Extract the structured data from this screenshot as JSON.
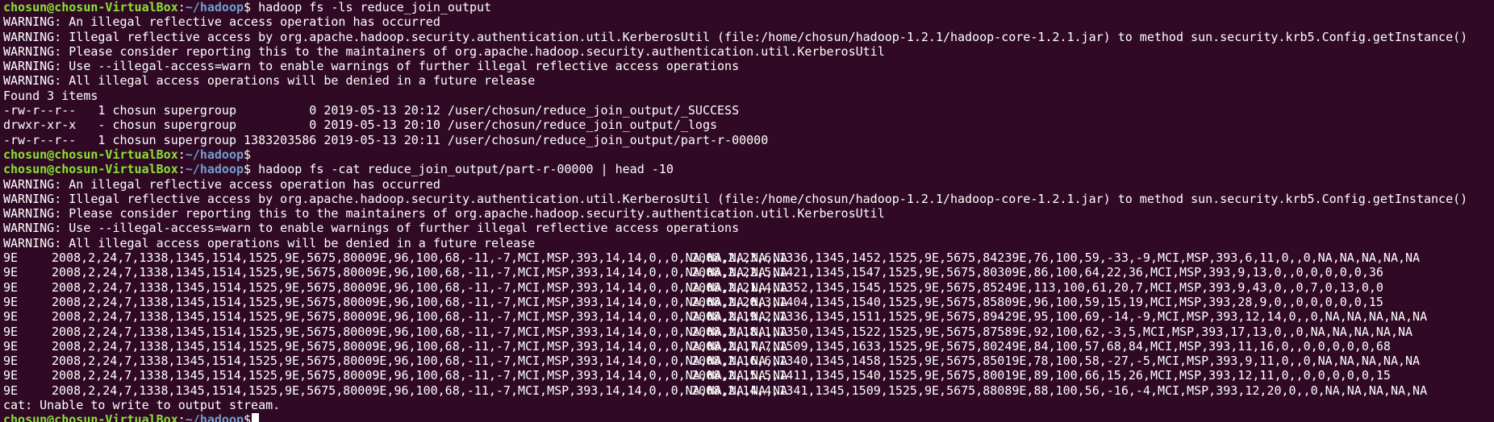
{
  "prompt": {
    "user_host": "chosun@chosun-VirtualBox",
    "colon": ":",
    "path": "~/hadoop",
    "symbol": "$"
  },
  "commands": {
    "ls": " hadoop fs -ls reduce_join_output",
    "cat": " hadoop fs -cat reduce_join_output/part-r-00000 | head -10",
    "empty": ""
  },
  "warnings": [
    "WARNING: An illegal reflective access operation has occurred",
    "WARNING: Illegal reflective access by org.apache.hadoop.security.authentication.util.KerberosUtil (file:/home/chosun/hadoop-1.2.1/hadoop-core-1.2.1.jar) to method sun.security.krb5.Config.getInstance()",
    "WARNING: Please consider reporting this to the maintainers of org.apache.hadoop.security.authentication.util.KerberosUtil",
    "WARNING: Use --illegal-access=warn to enable warnings of further illegal reflective access operations",
    "WARNING: All illegal access operations will be denied in a future release"
  ],
  "ls_output": {
    "found": "Found 3 items",
    "entries": [
      "-rw-r--r--   1 chosun supergroup          0 2019-05-13 20:12 /user/chosun/reduce_join_output/_SUCCESS",
      "drwxr-xr-x   - chosun supergroup          0 2019-05-13 20:10 /user/chosun/reduce_join_output/_logs",
      "-rw-r--r--   1 chosun supergroup 1383203586 2019-05-13 20:11 /user/chosun/reduce_join_output/part-r-00000"
    ]
  },
  "cat_output": {
    "rows": [
      {
        "key": "9E",
        "left": "2008,2,24,7,1338,1345,1514,1525,9E,5675,80009E,96,100,68,-11,-7,MCI,MSP,393,14,14,0,,0,NA,NA,NA,NA,NA",
        "right": "2008,2,23,6,1336,1345,1452,1525,9E,5675,84239E,76,100,59,-33,-9,MCI,MSP,393,6,11,0,,0,NA,NA,NA,NA,NA"
      },
      {
        "key": "9E",
        "left": "2008,2,24,7,1338,1345,1514,1525,9E,5675,80009E,96,100,68,-11,-7,MCI,MSP,393,14,14,0,,0,NA,NA,NA,NA,NA",
        "right": "2008,2,22,5,1421,1345,1547,1525,9E,5675,80309E,86,100,64,22,36,MCI,MSP,393,9,13,0,,0,0,0,0,0,36"
      },
      {
        "key": "9E",
        "left": "2008,2,24,7,1338,1345,1514,1525,9E,5675,80009E,96,100,68,-11,-7,MCI,MSP,393,14,14,0,,0,NA,NA,NA,NA,NA",
        "right": "2008,2,21,4,1352,1345,1545,1525,9E,5675,85249E,113,100,61,20,7,MCI,MSP,393,9,43,0,,0,7,0,13,0,0"
      },
      {
        "key": "9E",
        "left": "2008,2,24,7,1338,1345,1514,1525,9E,5675,80009E,96,100,68,-11,-7,MCI,MSP,393,14,14,0,,0,NA,NA,NA,NA,NA",
        "right": "2008,2,20,3,1404,1345,1540,1525,9E,5675,85809E,96,100,59,15,19,MCI,MSP,393,28,9,0,,0,0,0,0,0,15"
      },
      {
        "key": "9E",
        "left": "2008,2,24,7,1338,1345,1514,1525,9E,5675,80009E,96,100,68,-11,-7,MCI,MSP,393,14,14,0,,0,NA,NA,NA,NA,NA",
        "right": "2008,2,19,2,1336,1345,1511,1525,9E,5675,89429E,95,100,69,-14,-9,MCI,MSP,393,12,14,0,,0,NA,NA,NA,NA,NA"
      },
      {
        "key": "9E",
        "left": "2008,2,24,7,1338,1345,1514,1525,9E,5675,80009E,96,100,68,-11,-7,MCI,MSP,393,14,14,0,,0,NA,NA,NA,NA,NA",
        "right": "2008,2,18,1,1350,1345,1522,1525,9E,5675,87589E,92,100,62,-3,5,MCI,MSP,393,17,13,0,,0,NA,NA,NA,NA,NA"
      },
      {
        "key": "9E",
        "left": "2008,2,24,7,1338,1345,1514,1525,9E,5675,80009E,96,100,68,-11,-7,MCI,MSP,393,14,14,0,,0,NA,NA,NA,NA,NA",
        "right": "2008,2,17,7,1509,1345,1633,1525,9E,5675,80249E,84,100,57,68,84,MCI,MSP,393,11,16,0,,0,0,0,0,0,68"
      },
      {
        "key": "9E",
        "left": "2008,2,24,7,1338,1345,1514,1525,9E,5675,80009E,96,100,68,-11,-7,MCI,MSP,393,14,14,0,,0,NA,NA,NA,NA,NA",
        "right": "2008,2,16,6,1340,1345,1458,1525,9E,5675,85019E,78,100,58,-27,-5,MCI,MSP,393,9,11,0,,0,NA,NA,NA,NA,NA"
      },
      {
        "key": "9E",
        "left": "2008,2,24,7,1338,1345,1514,1525,9E,5675,80009E,96,100,68,-11,-7,MCI,MSP,393,14,14,0,,0,NA,NA,NA,NA,NA",
        "right": "2008,2,15,5,1411,1345,1540,1525,9E,5675,80019E,89,100,66,15,26,MCI,MSP,393,12,11,0,,0,0,0,0,0,15"
      },
      {
        "key": "9E",
        "left": "2008,2,24,7,1338,1345,1514,1525,9E,5675,80009E,96,100,68,-11,-7,MCI,MSP,393,14,14,0,,0,NA,NA,NA,NA,NA",
        "right": "2008,2,14,4,1341,1345,1509,1525,9E,5675,88089E,88,100,56,-16,-4,MCI,MSP,393,12,20,0,,0,NA,NA,NA,NA,NA"
      }
    ],
    "error": "cat: Unable to write to output stream."
  },
  "colors": {
    "background": "#300a24",
    "text": "#ffffff",
    "user_host": "#8ae234",
    "path": "#729fcf"
  }
}
